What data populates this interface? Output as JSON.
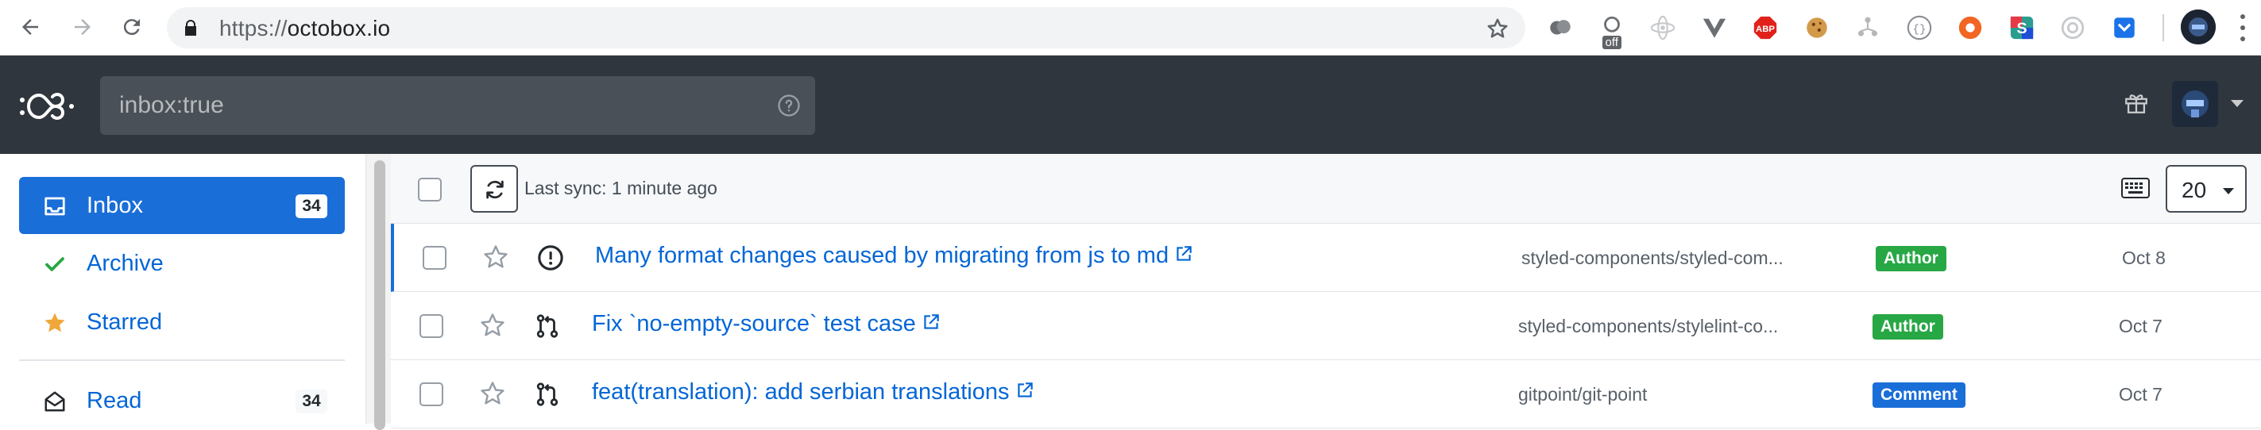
{
  "browser": {
    "url_scheme": "https://",
    "url_host": "octobox.io",
    "extension_off_tag": "off"
  },
  "header": {
    "search_placeholder": "inbox:true"
  },
  "sidebar": {
    "items": [
      {
        "label": "Inbox",
        "count": "34",
        "icon": "inbox-icon",
        "active": true
      },
      {
        "label": "Archive",
        "icon": "check-icon"
      },
      {
        "label": "Starred",
        "icon": "star-icon"
      },
      {
        "label": "Read",
        "count": "34",
        "icon": "envelope-open-icon"
      }
    ]
  },
  "toolbar": {
    "sync_text": "Last sync: 1 minute ago",
    "per_page": "20"
  },
  "notifications": [
    {
      "title": "Many format changes caused by migrating from js to md",
      "repo": "styled-components/styled-components",
      "repo_display": "styled-components/styled-com...",
      "badge": "Author",
      "badge_color": "#28a745",
      "date": "Oct 8",
      "type": "issue-icon"
    },
    {
      "title": "Fix `no-empty-source` test case",
      "repo": "styled-components/stylelint-config-styled-components",
      "repo_display": "styled-components/stylelint-co...",
      "badge": "Author",
      "badge_color": "#28a745",
      "date": "Oct 7",
      "type": "pull-request-icon"
    },
    {
      "title": "feat(translation): add serbian translations",
      "repo": "gitpoint/git-point",
      "repo_display": "gitpoint/git-point",
      "badge": "Comment",
      "badge_color": "#1a6ed8",
      "date": "Oct 7",
      "type": "pull-request-icon"
    }
  ],
  "colors": {
    "header_bg": "#2f363d",
    "accent": "#1a6ed8",
    "link": "#0366d6"
  }
}
